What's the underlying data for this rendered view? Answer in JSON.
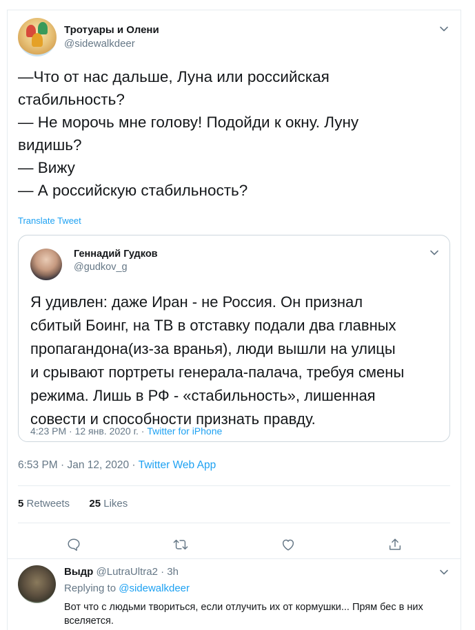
{
  "tweet": {
    "author_name": "Тротуары и Олени",
    "author_handle": "@sidewalkdeer",
    "text_lines": [
      "—Что от нас дальше, Луна или российская",
      "стабильность?",
      "— Не морочь мне голову! Подойди к окну. Луну",
      "видишь?",
      "— Вижу",
      "— А российскую стабильность?"
    ],
    "translate_label": "Translate Tweet",
    "time": "6:53 PM · Jan 12, 2020 · ",
    "source": "Twitter Web App",
    "retweets_count": "5",
    "retweets_label": "Retweets",
    "likes_count": "25",
    "likes_label": "Likes"
  },
  "quote": {
    "author_name": "Геннадий Гудков",
    "author_handle": "@gudkov_g",
    "text_lines": [
      "Я удивлен: даже Иран - не Россия. Он признал",
      "сбитый Боинг, на ТВ в отставку подали два главных",
      "пропагандона(из-за вранья), люди вышли на улицы",
      "и срывают портреты генерала-палача, требуя смены",
      "режима. Лишь в РФ - «стабильность», лишенная",
      "совести и способности признать правду."
    ],
    "time": "4:23 PM · 12 янв. 2020 г. · ",
    "source": "Twitter for iPhone"
  },
  "reply": {
    "author_name": "Выдр",
    "author_handle": "@LutraUltra2",
    "age": "· 3h",
    "replying_prefix": "Replying to ",
    "replying_handle": "@sidewalkdeer",
    "text": "Вот что с людьми твориться, если отлучить их от кормушки... Прям бес в них вселяется."
  },
  "icons": {
    "reply": "comment-icon",
    "retweet": "retweet-icon",
    "like": "heart-icon",
    "share": "share-icon",
    "menu": "chevron-down-icon"
  },
  "colors": {
    "link": "#1da1f2",
    "muted": "#657786",
    "text": "#14171a",
    "border": "#e6ecf0"
  }
}
